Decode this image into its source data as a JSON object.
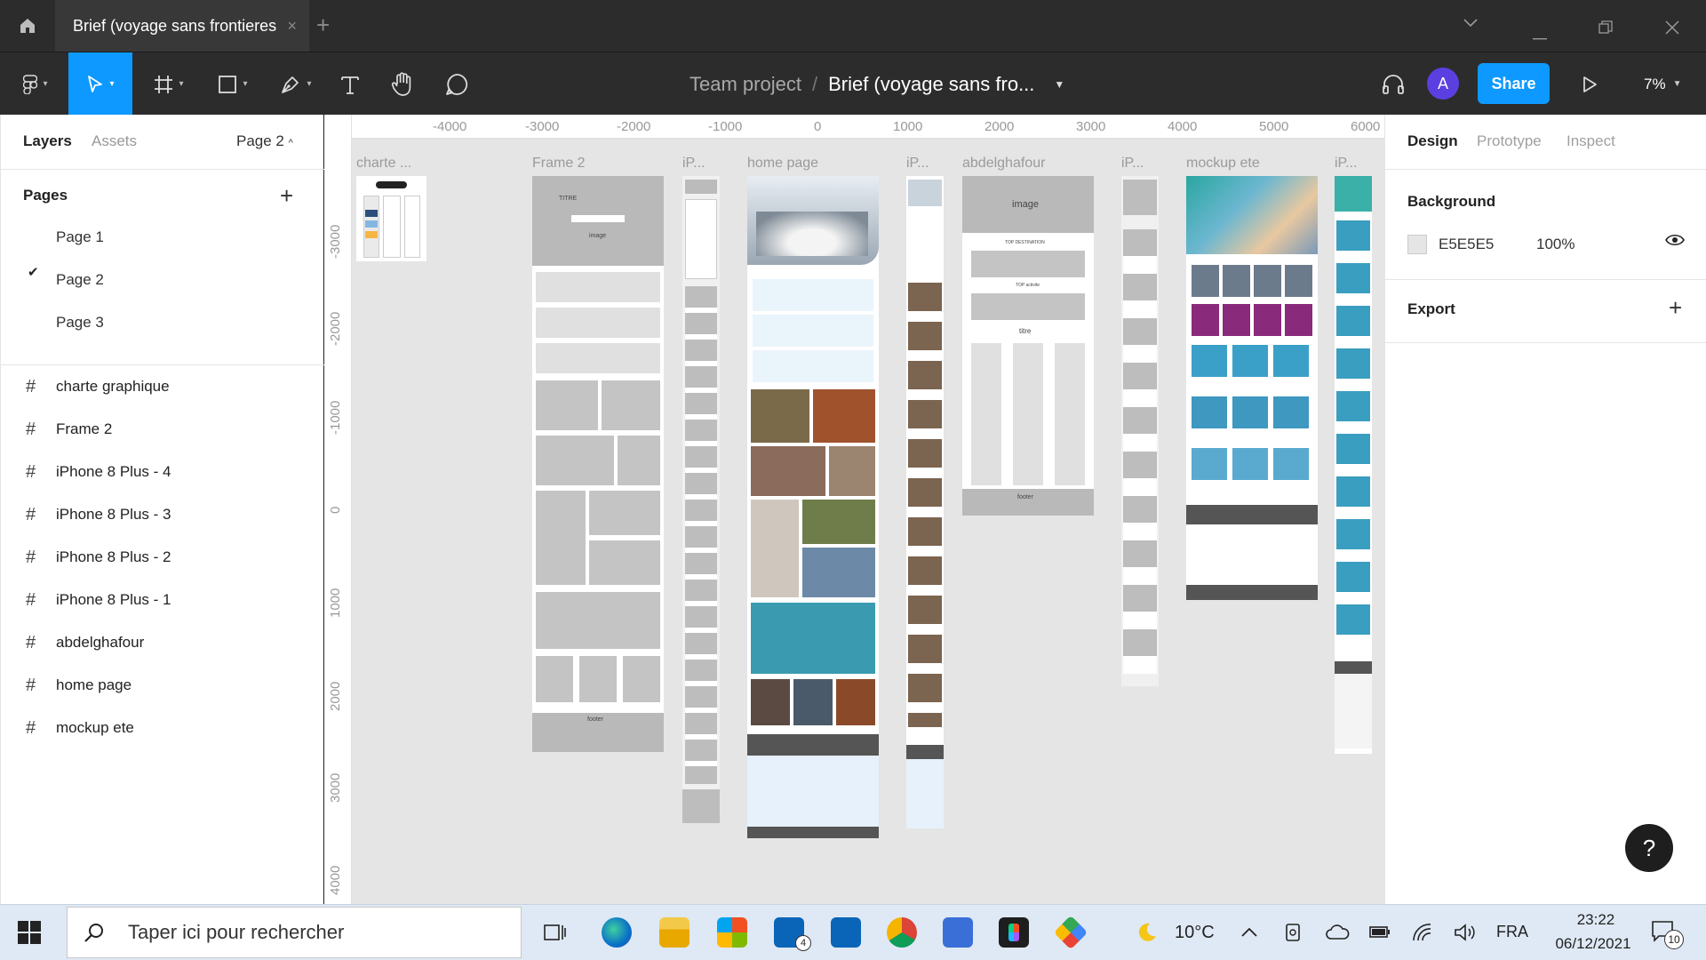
{
  "window": {
    "tab_title": "Brief (voyage sans frontieres",
    "tab_close": "×",
    "new_tab": "+"
  },
  "toolbar": {
    "team": "Team project",
    "separator": "/",
    "file_name": "Brief (voyage sans fro...",
    "avatar_initial": "A",
    "share_label": "Share",
    "zoom": "7%"
  },
  "left_panel": {
    "tabs": [
      "Layers",
      "Assets"
    ],
    "current_page": "Page 2",
    "pages_header": "Pages",
    "pages": [
      "Page 1",
      "Page 2",
      "Page 3"
    ],
    "selected_page_index": 1,
    "layers": [
      "charte graphique",
      "Frame 2",
      "iPhone 8 Plus - 4",
      "iPhone 8 Plus - 3",
      "iPhone 8 Plus - 2",
      "iPhone 8 Plus - 1",
      "abdelghafour",
      "home page",
      "mockup ete"
    ]
  },
  "canvas": {
    "ruler_x": [
      "000",
      "-4000",
      "-3000",
      "-2000",
      "-1000",
      "0",
      "1000",
      "2000",
      "3000",
      "4000",
      "5000",
      "6000"
    ],
    "ruler_y": [
      "-3000",
      "-2000",
      "-1000",
      "0",
      "1000",
      "2000",
      "3000",
      "4000"
    ],
    "frame_labels": {
      "charte": "charte ...",
      "frame2": "Frame 2",
      "ip1": "iP...",
      "home": "home page",
      "ip2": "iP...",
      "abdel": "abdelghafour",
      "ip3": "iP...",
      "mockup": "mockup ete",
      "ip4": "iP..."
    },
    "frame_texts": {
      "image": "image",
      "top_destination": "TOP DESTINATION",
      "top_activite": "TOP activite",
      "titre": "titre",
      "footer": "footer",
      "titre_upper": "TITRE"
    }
  },
  "right_panel": {
    "tabs": [
      "Design",
      "Prototype",
      "Inspect"
    ],
    "background_title": "Background",
    "background_hex": "E5E5E5",
    "background_opacity": "100%",
    "export_title": "Export",
    "help": "?"
  },
  "taskbar": {
    "search_placeholder": "Taper ici pour rechercher",
    "mail_badge": "4",
    "temperature": "10°C",
    "language": "FRA",
    "time": "23:22",
    "date": "06/12/2021",
    "notification_count": "10"
  },
  "colors": {
    "accent": "#0d99ff",
    "avatar": "#5b3fe0",
    "toolbar_bg": "#2c2c2c",
    "canvas_bg": "#E5E5E5"
  }
}
